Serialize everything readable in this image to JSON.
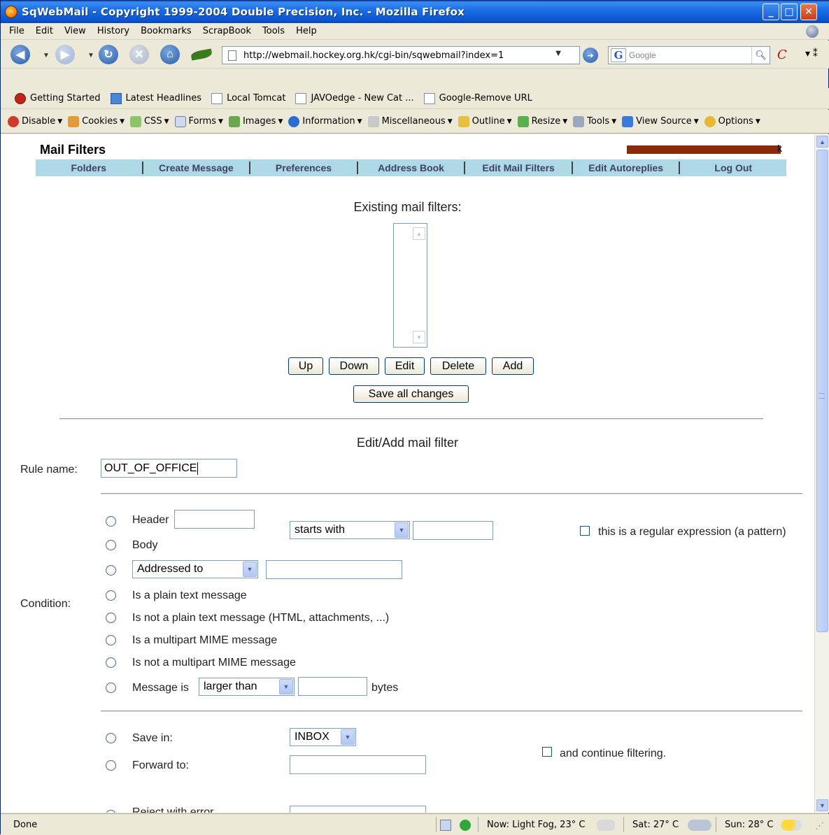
{
  "window": {
    "title": "SqWebMail - Copyright 1999-2004 Double Precision, Inc. - Mozilla Firefox"
  },
  "menu": [
    "File",
    "Edit",
    "View",
    "History",
    "Bookmarks",
    "ScrapBook",
    "Tools",
    "Help"
  ],
  "nav": {
    "url": "http://webmail.hockey.org.hk/cgi-bin/sqwebmail?index=1",
    "search_placeholder": "Google"
  },
  "bookmarks": [
    "Getting Started",
    "Latest Headlines",
    "Local Tomcat",
    "JAVOedge - New Cat ...",
    "Google-Remove URL"
  ],
  "devtools": [
    "Disable",
    "Cookies",
    "CSS",
    "Forms",
    "Images",
    "Information",
    "Miscellaneous",
    "Outline",
    "Resize",
    "Tools",
    "View Source",
    "Options"
  ],
  "page": {
    "title": "Mail Filters",
    "user_suffix": "k",
    "nav": [
      "Folders",
      "Create Message",
      "Preferences",
      "Address Book",
      "Edit Mail Filters",
      "Edit Autoreplies",
      "Log Out"
    ],
    "existing_heading": "Existing mail filters:",
    "buttons": {
      "up": "Up",
      "down": "Down",
      "edit": "Edit",
      "delete": "Delete",
      "add": "Add",
      "save": "Save all changes"
    },
    "edit_heading": "Edit/Add mail filter",
    "rule_name_label": "Rule name:",
    "rule_name_value": "OUT_OF_OFFICE",
    "condition_label": "Condition:",
    "conditions": {
      "header": "Header",
      "body": "Body",
      "match_select": "starts with",
      "regex_label": "this is a regular expression (a pattern)",
      "addressed_select": "Addressed to",
      "plain": "Is a plain text message",
      "not_plain": "Is not a plain text message (HTML, attachments, ...)",
      "multipart": "Is a multipart MIME message",
      "not_multipart": "Is not a multipart MIME message",
      "message_is": "Message is",
      "size_select": "larger than",
      "bytes": "bytes"
    },
    "actions": {
      "save_in": "Save in:",
      "folder_select": "INBOX",
      "continue_label": "and continue filtering.",
      "forward_to": "Forward to:",
      "reject_partial": "Reject with error"
    }
  },
  "status": {
    "done": "Done",
    "now": "Now: Light Fog, 23° C",
    "sat": "Sat: 27° C",
    "sun": "Sun: 28° C"
  }
}
